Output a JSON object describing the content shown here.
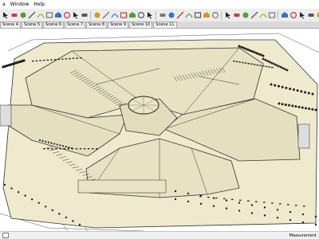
{
  "menubar": {
    "items": [
      "a",
      "Window",
      "Help"
    ]
  },
  "toolbar": {
    "tools": [
      "select-icon",
      "eraser-icon",
      "paint-bucket-icon",
      "line-icon",
      "arc-icon",
      "rectangle-icon",
      "push-pull-icon",
      "rotate-icon",
      "move-icon",
      "scale-icon",
      "offset-icon",
      "tape-measure-icon",
      "dimension-icon",
      "protractor-icon",
      "text-icon",
      "axes-icon",
      "3d-text-icon",
      "orbit-icon",
      "pan-icon",
      "zoom-icon",
      "zoom-window-icon",
      "zoom-extents-icon",
      "previous-view-icon",
      "next-view-icon",
      "iso-view-icon",
      "top-view-icon",
      "front-view-icon",
      "right-view-icon",
      "back-view-icon",
      "left-view-icon",
      "xray-icon",
      "wireframe-icon",
      "hidden-line-icon",
      "shaded-icon",
      "shaded-textures-icon",
      "monochrome-icon",
      "sandbox-icon",
      "components-icon",
      "geo-location-icon",
      "section-plane-icon"
    ]
  },
  "scenes": {
    "tabs": [
      "Scene 4",
      "Scene 5",
      "Scene 6",
      "Scene 7",
      "Scene 8",
      "Scene 9",
      "Scene 10",
      "Scene 11"
    ]
  },
  "statusbar": {
    "measurements_label": "Measurement"
  },
  "colors": {
    "model_fill": "#ece7c9",
    "model_line": "#333333",
    "toolbar_bg": "#ececec",
    "viewport_bg": "#ffffff"
  }
}
